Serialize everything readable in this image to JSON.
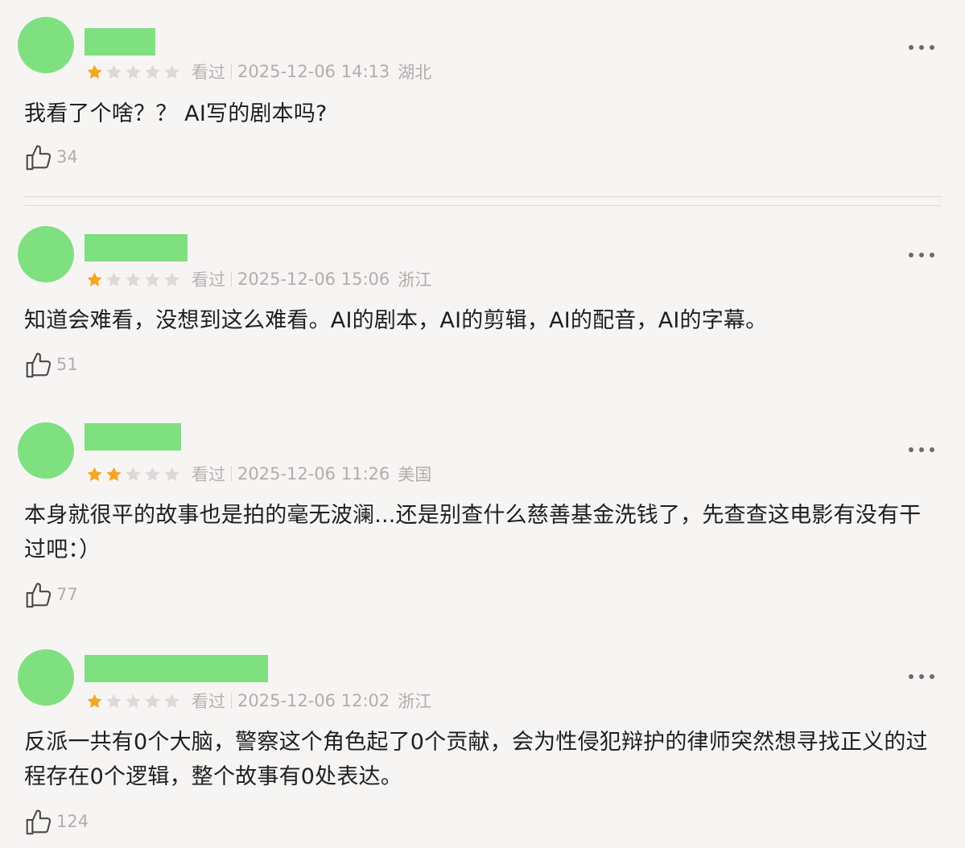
{
  "reviews": [
    {
      "rating": 1,
      "watched": "看过",
      "datetime": "2025-12-06 14:13",
      "location": "湖北",
      "content": "我看了个啥？？ AI写的剧本吗?",
      "likes": "34"
    },
    {
      "rating": 1,
      "watched": "看过",
      "datetime": "2025-12-06 15:06",
      "location": "浙江",
      "content": "知道会难看，没想到这么难看。AI的剧本，AI的剪辑，AI的配音，AI的字幕。",
      "likes": "51"
    },
    {
      "rating": 2,
      "watched": "看过",
      "datetime": "2025-12-06 11:26",
      "location": "美国",
      "content": "本身就很平的故事也是拍的毫无波澜...还是别查什么慈善基金洗钱了，先查查这电影有没有干过吧：）",
      "likes": "77"
    },
    {
      "rating": 1,
      "watched": "看过",
      "datetime": "2025-12-06 12:02",
      "location": "浙江",
      "content": "反派一共有0个大脑，警察这个角色起了0个贡献，会为性侵犯辩护的律师突然想寻找正义的过程存在0个逻辑，整个故事有0处表达。",
      "likes": "124"
    }
  ],
  "colors": {
    "star_filled": "#f5a623",
    "star_empty": "#dcdad8",
    "avatar_redaction": "#7fe07f",
    "background": "#f7f5f4"
  },
  "icons": {
    "like": "thumbs-up-icon",
    "more": "more-dots-icon"
  }
}
